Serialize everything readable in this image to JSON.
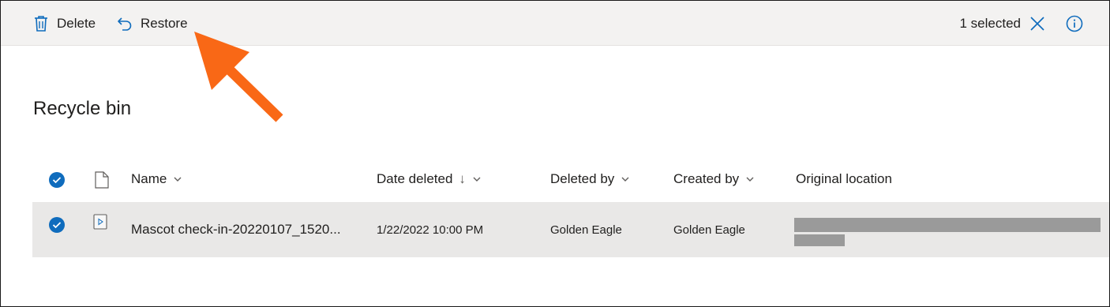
{
  "toolbar": {
    "delete_label": "Delete",
    "restore_label": "Restore",
    "selection_text": "1 selected"
  },
  "page": {
    "title": "Recycle bin"
  },
  "columns": {
    "name": "Name",
    "date_deleted": "Date deleted",
    "date_deleted_sort": "↓",
    "deleted_by": "Deleted by",
    "created_by": "Created by",
    "original_location": "Original location"
  },
  "rows": [
    {
      "name": "Mascot check-in-20220107_1520...",
      "date_deleted": "1/22/2022 10:00 PM",
      "deleted_by": "Golden Eagle",
      "created_by": "Golden Eagle",
      "selected": true
    }
  ],
  "icons": {
    "delete": "trash-icon",
    "restore": "undo-icon",
    "clear": "close-icon",
    "info": "info-icon",
    "file": "file-icon",
    "video": "video-file-icon"
  },
  "colors": {
    "accent": "#0f6cbd",
    "toolbar_bg": "#f3f2f1",
    "selected_row_bg": "#e9e8e7",
    "annotation_arrow": "#f96816",
    "redaction": "#9a9a9a"
  }
}
